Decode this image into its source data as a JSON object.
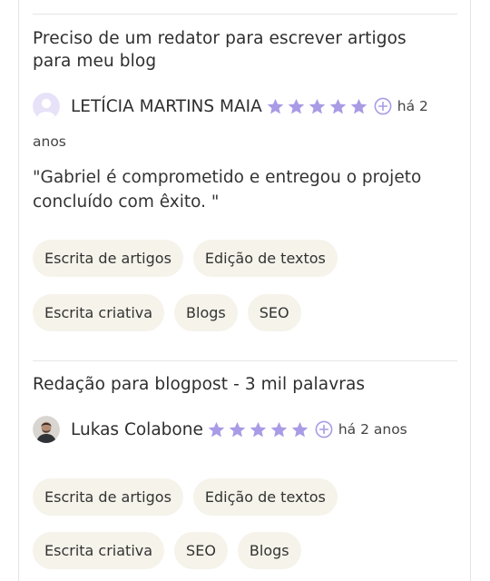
{
  "reviews": [
    {
      "title": "Preciso de um redator para escrever artigos para meu blog",
      "author": "LETÍCIA MARTINS MAIA",
      "time_part1": "há 2",
      "time_part2": "anos",
      "rating": 5,
      "comment": "\"Gabriel é comprometido e entregou o projeto concluído com êxito. \"",
      "tags_row1": [
        "Escrita de artigos",
        "Edição de textos"
      ],
      "tags_row2": [
        "Escrita criativa",
        "Blogs",
        "SEO"
      ]
    },
    {
      "title": "Redação para blogpost - 3 mil palavras",
      "author": "Lukas Colabone",
      "time": "há 2 anos",
      "rating": 5,
      "tags_row1": [
        "Escrita de artigos",
        "Edição de textos"
      ],
      "tags_row2": [
        "Escrita criativa",
        "SEO",
        "Blogs"
      ]
    }
  ],
  "colors": {
    "star": "#a99be6",
    "plus_icon": "#a99be6",
    "tag_background": "#f5f3ea",
    "divider": "#e6e6e6"
  },
  "icons": {
    "rating": "star-icon",
    "more": "plus-circle-icon",
    "default_avatar": "user-avatar-icon"
  }
}
